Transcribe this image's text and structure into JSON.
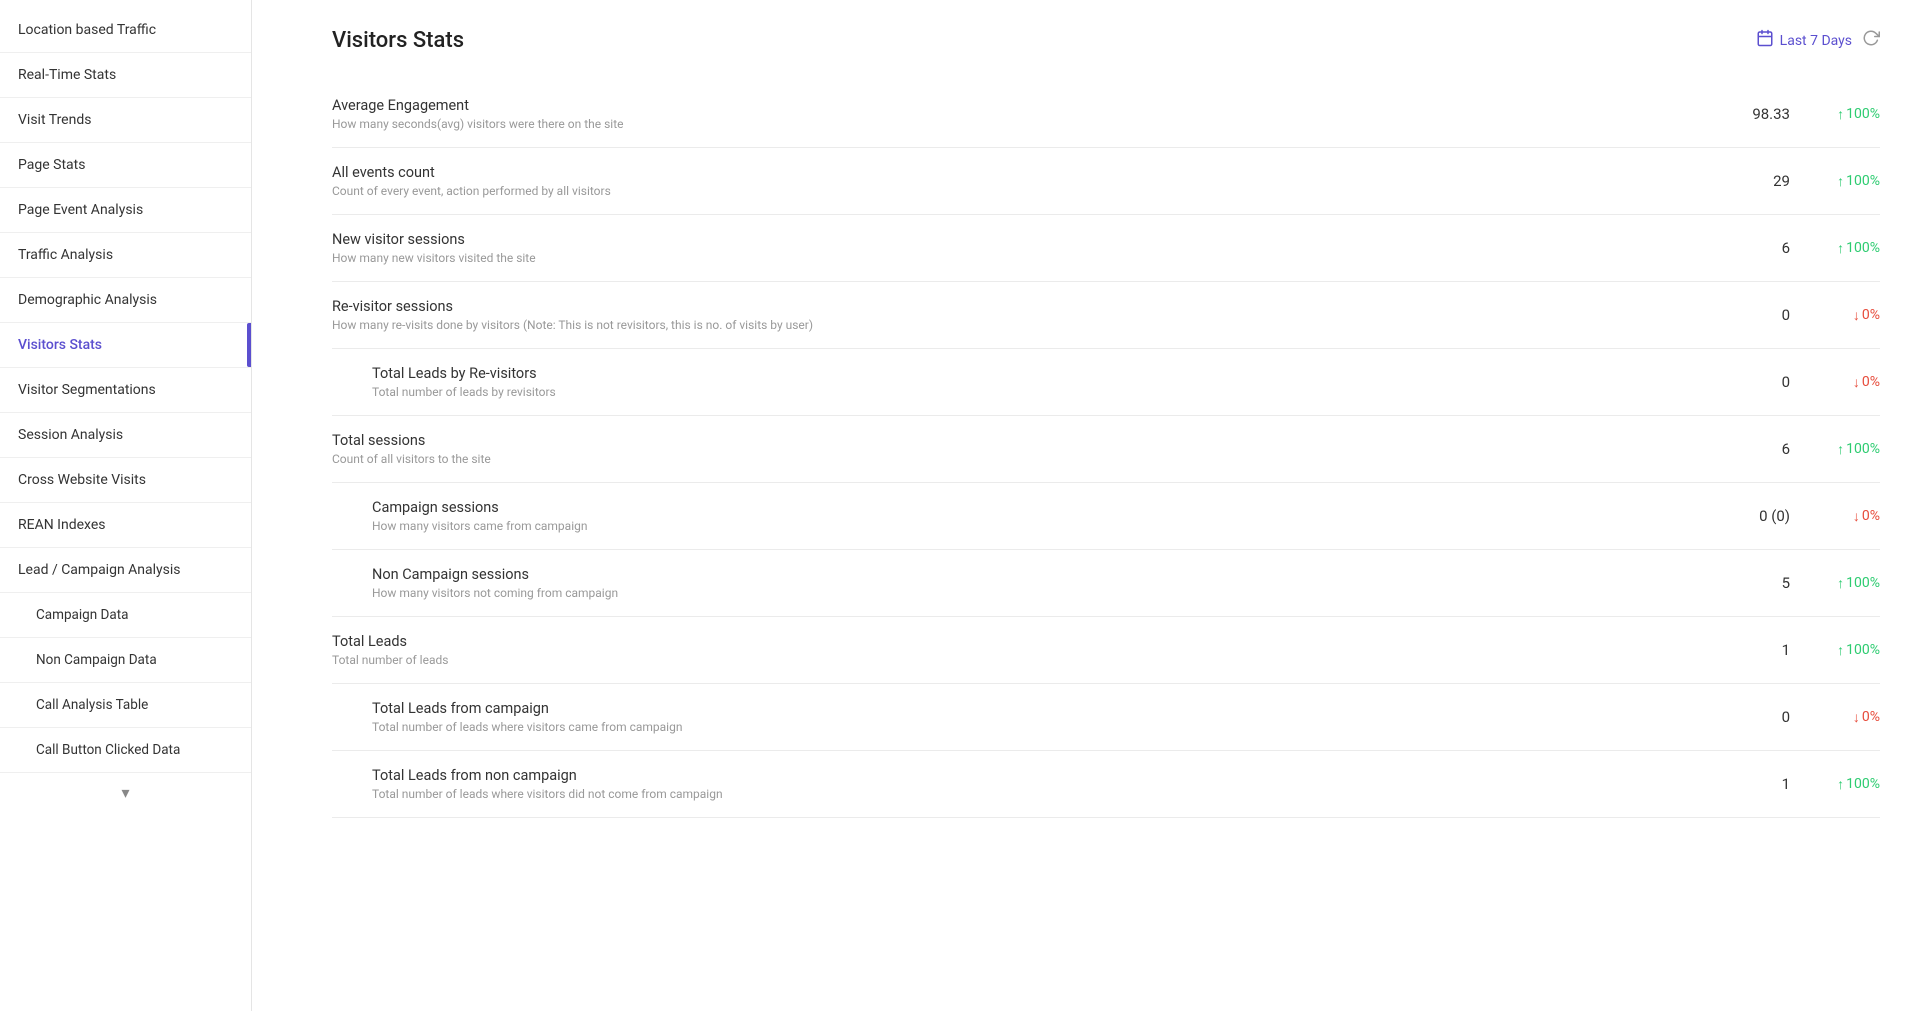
{
  "sidebar": {
    "items": [
      {
        "label": "Location based Traffic",
        "id": "location-based-traffic",
        "active": false,
        "sub": false
      },
      {
        "label": "Real-Time Stats",
        "id": "real-time-stats",
        "active": false,
        "sub": false
      },
      {
        "label": "Visit Trends",
        "id": "visit-trends",
        "active": false,
        "sub": false
      },
      {
        "label": "Page Stats",
        "id": "page-stats",
        "active": false,
        "sub": false
      },
      {
        "label": "Page Event Analysis",
        "id": "page-event-analysis",
        "active": false,
        "sub": false
      },
      {
        "label": "Traffic Analysis",
        "id": "traffic-analysis",
        "active": false,
        "sub": false
      },
      {
        "label": "Demographic Analysis",
        "id": "demographic-analysis",
        "active": false,
        "sub": false
      },
      {
        "label": "Visitors Stats",
        "id": "visitors-stats",
        "active": true,
        "sub": false
      },
      {
        "label": "Visitor Segmentations",
        "id": "visitor-segmentations",
        "active": false,
        "sub": false
      },
      {
        "label": "Session Analysis",
        "id": "session-analysis",
        "active": false,
        "sub": false
      },
      {
        "label": "Cross Website Visits",
        "id": "cross-website-visits",
        "active": false,
        "sub": false
      },
      {
        "label": "REAN Indexes",
        "id": "rean-indexes",
        "active": false,
        "sub": false
      },
      {
        "label": "Lead / Campaign Analysis",
        "id": "lead-campaign-analysis",
        "active": false,
        "sub": false
      },
      {
        "label": "Campaign Data",
        "id": "campaign-data",
        "active": false,
        "sub": true
      },
      {
        "label": "Non Campaign Data",
        "id": "non-campaign-data",
        "active": false,
        "sub": true
      },
      {
        "label": "Call Analysis Table",
        "id": "call-analysis-table",
        "active": false,
        "sub": true
      },
      {
        "label": "Call Button Clicked Data",
        "id": "call-button-clicked-data",
        "active": false,
        "sub": true
      }
    ],
    "chevron_label": "▾"
  },
  "page": {
    "title": "Visitors Stats",
    "date_filter": "Last 7 Days"
  },
  "stats": [
    {
      "name": "Average Engagement",
      "desc": "How many seconds(avg) visitors were there on the site",
      "value": "98.33",
      "change": "100%",
      "direction": "up",
      "indented": false
    },
    {
      "name": "All events count",
      "desc": "Count of every event, action performed by all visitors",
      "value": "29",
      "change": "100%",
      "direction": "up",
      "indented": false
    },
    {
      "name": "New visitor sessions",
      "desc": "How many new visitors visited the site",
      "value": "6",
      "change": "100%",
      "direction": "up",
      "indented": false
    },
    {
      "name": "Re-visitor sessions",
      "desc": "How many re-visits done by visitors (Note: This is not revisitors, this is no. of visits by user)",
      "value": "0",
      "change": "0%",
      "direction": "down",
      "indented": false
    },
    {
      "name": "Total Leads by Re-visitors",
      "desc": "Total number of leads by revisitors",
      "value": "0",
      "change": "0%",
      "direction": "down",
      "indented": true
    },
    {
      "name": "Total sessions",
      "desc": "Count of all visitors to the site",
      "value": "6",
      "change": "100%",
      "direction": "up",
      "indented": false
    },
    {
      "name": "Campaign sessions",
      "desc": "How many visitors came from campaign",
      "value": "0 (0)",
      "change": "0%",
      "direction": "down",
      "indented": true
    },
    {
      "name": "Non Campaign sessions",
      "desc": "How many visitors not coming from campaign",
      "value": "5",
      "change": "100%",
      "direction": "up",
      "indented": true
    },
    {
      "name": "Total Leads",
      "desc": "Total number of leads",
      "value": "1",
      "change": "100%",
      "direction": "up",
      "indented": false
    },
    {
      "name": "Total Leads from campaign",
      "desc": "Total number of leads where visitors came from campaign",
      "value": "0",
      "change": "0%",
      "direction": "down",
      "indented": true
    },
    {
      "name": "Total Leads from non campaign",
      "desc": "Total number of leads where visitors did not come from campaign",
      "value": "1",
      "change": "100%",
      "direction": "up",
      "indented": true
    }
  ]
}
